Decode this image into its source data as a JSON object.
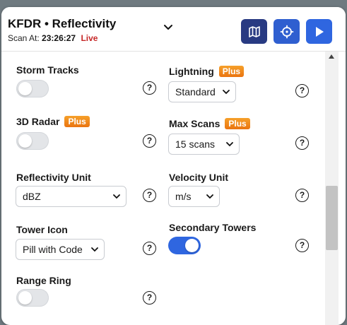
{
  "header": {
    "title": "KFDR • Reflectivity",
    "scan_label": "Scan At:",
    "scan_time": "23:26:27",
    "live": "Live",
    "buttons": [
      "map-icon",
      "crosshair-icon",
      "play-icon"
    ]
  },
  "colors": {
    "plus_badge": "#f08a1c",
    "toggle_on": "#2f66e0",
    "map_button": "#283a82",
    "live": "#c62828"
  },
  "settings": {
    "storm_tracks": {
      "label": "Storm Tracks",
      "enabled": false
    },
    "lightning": {
      "label": "Lightning",
      "badge": "Plus",
      "value": "Standard"
    },
    "radar_3d": {
      "label": "3D Radar",
      "badge": "Plus",
      "enabled": false
    },
    "max_scans": {
      "label": "Max Scans",
      "badge": "Plus",
      "value": "15 scans"
    },
    "reflectivity_unit": {
      "label": "Reflectivity Unit",
      "value": "dBZ"
    },
    "velocity_unit": {
      "label": "Velocity Unit",
      "value": "m/s"
    },
    "tower_icon": {
      "label": "Tower Icon",
      "value": "Pill with Code"
    },
    "secondary_towers": {
      "label": "Secondary Towers",
      "enabled": true
    },
    "range_ring": {
      "label": "Range Ring",
      "enabled": false
    }
  },
  "help_glyph": "?"
}
